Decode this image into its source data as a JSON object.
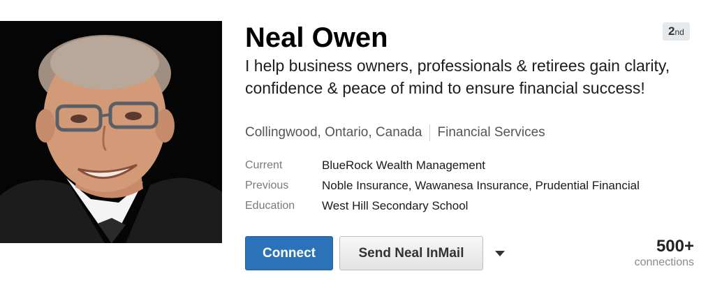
{
  "profile": {
    "name": "Neal Owen",
    "degree": {
      "number": "2",
      "suffix": "nd"
    },
    "headline": "I help business owners, professionals & retirees gain clarity, confidence & peace of mind to ensure financial success!",
    "location": "Collingwood, Ontario, Canada",
    "industry": "Financial Services"
  },
  "details": [
    {
      "label": "Current",
      "value": "BlueRock Wealth Management"
    },
    {
      "label": "Previous",
      "value": "Noble Insurance, Wawanesa Insurance, Prudential Financial"
    },
    {
      "label": "Education",
      "value": "West Hill Secondary School"
    }
  ],
  "actions": {
    "connect_label": "Connect",
    "inmail_label": "Send Neal InMail",
    "more_icon": "chevron-down-icon"
  },
  "connections": {
    "count": "500+",
    "label": "connections"
  },
  "colors": {
    "connect_button": "#2b72b8",
    "inmail_button": "#e9e9e9",
    "photo_background": "#000000"
  }
}
